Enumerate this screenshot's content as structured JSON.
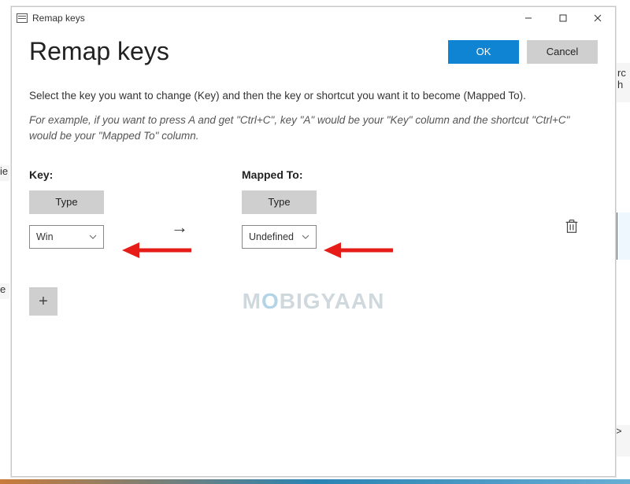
{
  "window": {
    "title": "Remap keys",
    "heading": "Remap keys",
    "buttons": {
      "ok": "OK",
      "cancel": "Cancel"
    },
    "instruction": "Select the key you want to change (Key) and then the key or shortcut you want it to become (Mapped To).",
    "example": "For example, if you want to press A and get \"Ctrl+C\", key \"A\" would be your \"Key\" column and the shortcut \"Ctrl+C\" would be your \"Mapped To\" column."
  },
  "columns": {
    "key_label": "Key:",
    "mapped_label": "Mapped To:",
    "type_button": "Type",
    "key_value": "Win",
    "mapped_value": "Undefined"
  },
  "watermark_parts": {
    "p1": "M",
    "p2": "O",
    "p3": "BIGYAAN"
  }
}
